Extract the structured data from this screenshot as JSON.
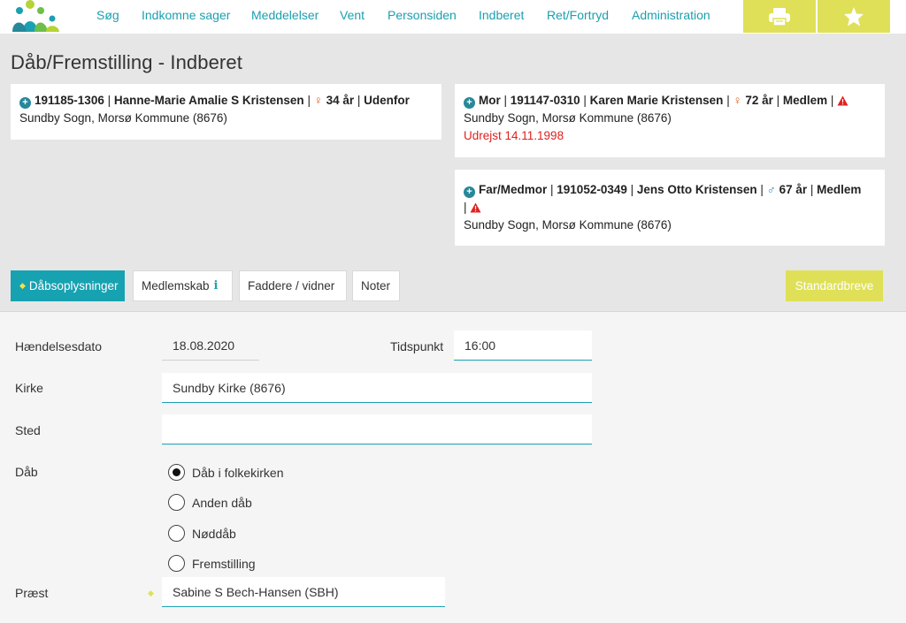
{
  "nav": {
    "items": [
      "Søg",
      "Indkomne sager",
      "Meddelelser",
      "Vent",
      "Personsiden",
      "Indberet",
      "Ret/Fortryd",
      "Administration"
    ],
    "print_icon": "printer-icon",
    "favorite_icon": "star-icon",
    "accent": "#dfe057",
    "link_color": "#1b9fb0"
  },
  "page": {
    "title": "Dåb/Fremstilling - Indberet"
  },
  "child": {
    "cpr": "191185-1306",
    "name": "Hanne-Marie Amalie S Kristensen",
    "age": "34 år",
    "status": "Udenfor",
    "address": "Sundby Sogn, Morsø Kommune (8676)"
  },
  "mother": {
    "role": "Mor",
    "cpr": "191147-0310",
    "name": "Karen Marie Kristensen",
    "age": "72 år",
    "status": "Medlem",
    "address": "Sundby Sogn, Morsø Kommune (8676)",
    "note": "Udrejst 14.11.1998"
  },
  "father": {
    "role": "Far/Medmor",
    "cpr": "191052-0349",
    "name": "Jens Otto Kristensen",
    "age": "67 år",
    "status": "Medlem",
    "address": "Sundby Sogn, Morsø Kommune (8676)"
  },
  "tabs": [
    "Dåbsoplysninger",
    "Medlemskab",
    "Faddere / vidner",
    "Noter"
  ],
  "standard_letters_label": "Standardbreve",
  "form": {
    "event_date_label": "Hændelsesdato",
    "event_date_value": "18.08.2020",
    "time_label": "Tidspunkt",
    "time_value": "16:00",
    "church_label": "Kirke",
    "church_value": "Sundby Kirke (8676)",
    "place_label": "Sted",
    "place_value": "",
    "baptism_label": "Dåb",
    "baptism_options": [
      "Dåb i folkekirken",
      "Anden dåb",
      "Nøddåb",
      "Fremstilling"
    ],
    "baptism_selected": "Dåb i folkekirken",
    "priest_label": "Præst",
    "priest_value": "Sabine S Bech-Hansen (SBH)"
  }
}
